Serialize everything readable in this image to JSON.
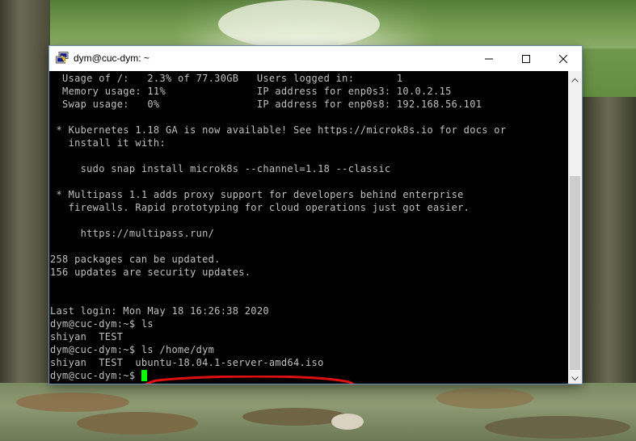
{
  "window": {
    "title": "dym@cuc-dym: ~",
    "icon": "putty-terminal-icon",
    "controls": {
      "minimize_icon": "minimize-icon",
      "maximize_icon": "maximize-icon",
      "close_icon": "close-icon"
    }
  },
  "terminal": {
    "background_color": "#000000",
    "text_color": "#c0c0c0",
    "cursor_color": "#00ff00",
    "lines": [
      "  Usage of /:   2.3% of 77.30GB   Users logged in:       1",
      "  Memory usage: 11%               IP address for enp0s3: 10.0.2.15",
      "  Swap usage:   0%                IP address for enp0s8: 192.168.56.101",
      "",
      " * Kubernetes 1.18 GA is now available! See https://microk8s.io for docs or",
      "   install it with:",
      "",
      "     sudo snap install microk8s --channel=1.18 --classic",
      "",
      " * Multipass 1.1 adds proxy support for developers behind enterprise",
      "   firewalls. Rapid prototyping for cloud operations just got easier.",
      "",
      "     https://multipass.run/",
      "",
      "258 packages can be updated.",
      "156 updates are security updates.",
      "",
      "",
      "Last login: Mon May 18 16:26:38 2020",
      "dym@cuc-dym:~$ ls",
      "shiyan  TEST",
      "dym@cuc-dym:~$ ls /home/dym",
      "shiyan  TEST  ubuntu-18.04.1-server-amd64.iso",
      "dym@cuc-dym:~$ "
    ],
    "annotation_color": "#e01010"
  },
  "scrollbar": {
    "up_icon": "scroll-up-arrow-icon",
    "down_icon": "scroll-down-arrow-icon",
    "position_fraction": 1.0,
    "visible_fraction": 0.68
  }
}
